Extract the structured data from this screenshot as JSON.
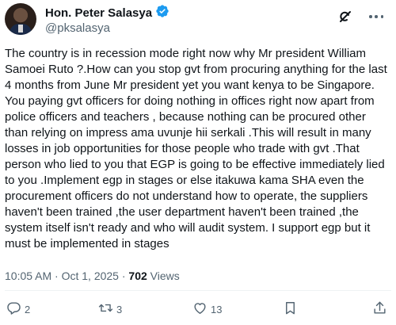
{
  "author": {
    "display_name": "Hon. Peter Salasya",
    "handle": "@pksalasya"
  },
  "icons": {
    "verified": "verified-badge-icon",
    "grok": "grok-icon",
    "more": "more-icon",
    "reply": "reply-icon",
    "repost": "repost-icon",
    "like": "like-icon",
    "bookmark": "bookmark-icon",
    "share": "share-icon"
  },
  "colors": {
    "verified": "#1d9bf0",
    "text": "#0f1419",
    "secondary": "#536471"
  },
  "tweet": {
    "lines": [
      "The country is in recession mode right now  why Mr president William",
      "Samoei Ruto ?.How can you stop gvt from procuring anything for the last",
      "4 months  from June Mr president yet you want kenya to be Singapore.",
      "You paying gvt officers for doing nothing in offices right now apart from",
      "police officers and teachers  , because nothing can be procured other",
      "than relying on impress  ama uvunje hii serkali .This will result in many",
      "losses in job opportunities for those people who trade with gvt .That",
      "person who lied to you that EGP is going to be effective immediately lied",
      "to you .Implement egp in stages or else itakuwa kama SHA even the",
      "procurement officers do not understand how to operate, the suppliers",
      "haven't been trained ,the user department haven't been trained ,the",
      "system itself isn't ready and who will audit system. I support egp but it",
      "must be implemented in stages"
    ],
    "timestamp": "10:05 AM · Oct 1, 2025 · ",
    "views_count": "702",
    "views_label": " Views"
  },
  "actions": {
    "replies": "2",
    "reposts": "3",
    "likes": "13"
  }
}
